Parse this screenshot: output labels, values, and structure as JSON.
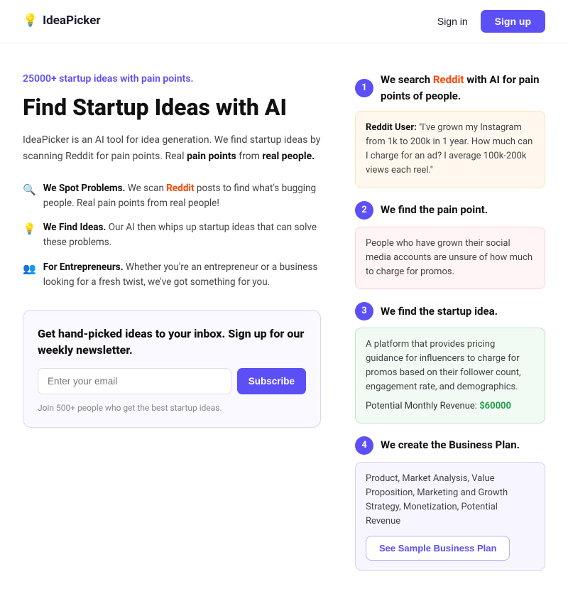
{
  "nav": {
    "logo_text": "IdeaPicker",
    "sign_in_label": "Sign in",
    "sign_up_label": "Sign up"
  },
  "hero": {
    "tagline": "25000+ startup ideas with pain points.",
    "headline": "Find Startup Ideas with AI",
    "description_parts": [
      "IdeaPicker is an AI tool for idea generation. We find startup ideas by scanning Reddit for pain points. Real ",
      "pain points",
      " from ",
      "real people."
    ],
    "features": [
      {
        "icon": "🔍",
        "label": "We Spot Problems.",
        "text_before": "We scan ",
        "reddit": "Reddit",
        "text_after": " posts to find what's bugging people. Real pain points from real people!"
      },
      {
        "icon": "💡",
        "label": "We Find Ideas.",
        "text": "Our AI then whips up startup ideas that can solve these problems."
      },
      {
        "icon": "👥",
        "label": "For Entrepreneurs.",
        "text": "Whether you're an entrepreneur or a business looking for a fresh twist, we've got something for you."
      }
    ],
    "newsletter": {
      "title": "Get hand-picked ideas to your inbox. Sign up for our weekly newsletter.",
      "input_placeholder": "Enter your email",
      "subscribe_label": "Subscribe",
      "note": "Join 500+ people who get the best startup ideas."
    }
  },
  "steps": [
    {
      "number": "1",
      "title": "We search Reddit with AI for pain points of people.",
      "card_type": "orange",
      "card_label": "Reddit User:",
      "card_text": "\"I've grown my Instagram from 1k to 200k in 1 year. How much can I charge for an ad? I average 100k-200k views each reel.\""
    },
    {
      "number": "2",
      "title": "We find the pain point.",
      "card_type": "pink",
      "card_text": "People who have grown their social media accounts are unsure of how much to charge for promos."
    },
    {
      "number": "3",
      "title": "We find the startup idea.",
      "card_type": "green",
      "card_text": "A platform that provides pricing guidance for influencers to charge for promos based on their follower count, engagement rate, and demographics.",
      "potential_label": "Potential Monthly Revenue:",
      "potential_value": "$60000"
    },
    {
      "number": "4",
      "title": "We create the Business Plan.",
      "card_type": "purple",
      "card_text": "Product, Market Analysis, Value Proposition, Marketing and Growth Strategy, Monetization, Potential Revenue",
      "sample_btn": "See Sample Business Plan"
    }
  ],
  "icons": {
    "logo": "💡",
    "search": "🔍",
    "idea": "💡",
    "people": "👥",
    "reddit": "Reddit"
  }
}
